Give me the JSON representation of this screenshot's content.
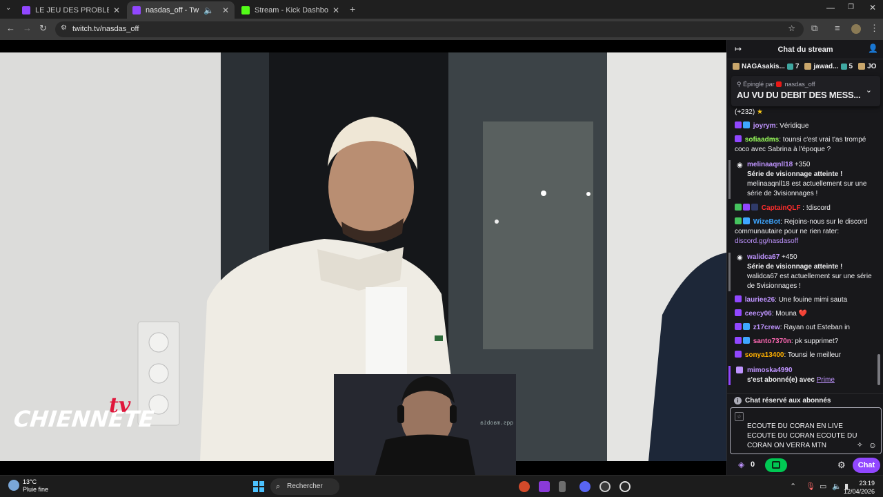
{
  "browser": {
    "tabs": [
      {
        "title": "LE JEU DES PROBLEMES ! - Twi",
        "favicon_color": "#9147ff",
        "active": false
      },
      {
        "title": "nasdas_off - Twitch",
        "favicon_color": "#9147ff",
        "active": true
      },
      {
        "title": "Stream - Kick Dashboard",
        "favicon_color": "#53fc18",
        "active": false
      }
    ],
    "url": "twitch.tv/nasdas_off"
  },
  "video": {
    "overlay_logo": "CHIENNETE",
    "overlay_logo_tv": "tv",
    "webcam_text": "qqs.maobia"
  },
  "chat": {
    "header_title": "Chat du stream",
    "gifters": [
      {
        "name": "NAGAsakis...",
        "count": "7"
      },
      {
        "name": "jawad...",
        "count": "5"
      },
      {
        "name": "JO",
        "count": ""
      }
    ],
    "pinned": {
      "by_label": "Épinglé par",
      "by_user": "nasdas_off",
      "message": "AU VU DU DEBIT DES MESS..."
    },
    "partial_line": "(+232)",
    "messages": [
      {
        "user": "joyrym",
        "color": "#bf94ff",
        "text": ": Véridique"
      },
      {
        "user": "sofiaadms",
        "color": "#9aff5c",
        "text": ": tounsi c'est vrai t'as trompé coco avec Sabrina à l'époque ?"
      },
      {
        "user": "CaptainQLF",
        "color": "#ff2d2d",
        "text": " : !discord"
      },
      {
        "user": "WizeBot",
        "color": "#3ea6ff",
        "text": ": Rejoins-nous sur le discord communautaire pour ne rien rater: ",
        "link": "discord.gg/nasdasoff"
      },
      {
        "user": "lauriee26",
        "color": "#bf94ff",
        "text": ": Une fouine mimi sauta"
      },
      {
        "user": "ceecy06",
        "color": "#bf94ff",
        "text": ": Mouna ❤️"
      },
      {
        "user": "z17crew",
        "color": "#bf94ff",
        "text": ": Rayan out Esteban in"
      },
      {
        "user": "santo7370n",
        "color": "#ff69b4",
        "text": ": pk supprimet?"
      },
      {
        "user": "sonya13400",
        "color": "#ffb000",
        "text": ": Tounsi le meilleur"
      }
    ],
    "notices": [
      {
        "user": "melinaaqnll18",
        "points": "+350",
        "title": "Série de visionnage atteinte !",
        "body": "melinaaqnll18 est actuellement sur une série de 3visionnages !"
      },
      {
        "user": "walidca67",
        "points": "+450",
        "title": "Série de visionnage atteinte !",
        "body": "walidca67 est actuellement sur une série de 5visionnages !"
      }
    ],
    "sub_notice": {
      "user": "mimoska4990",
      "text": "s'est abonné(e) avec ",
      "link": "Prime"
    },
    "sub_only_label": "Chat réservé aux abonnés",
    "input_value": "ECOUTE DU CORAN EN LIVE ECOUTE DU CORAN ECOUTE DU CORAN ON VERRA MTN",
    "points": "0",
    "chat_button": "Chat"
  },
  "taskbar": {
    "weather_temp": "13°C",
    "weather_desc": "Pluie fine",
    "search_placeholder": "Rechercher",
    "time": "23:19",
    "date": "12/04/2026"
  }
}
